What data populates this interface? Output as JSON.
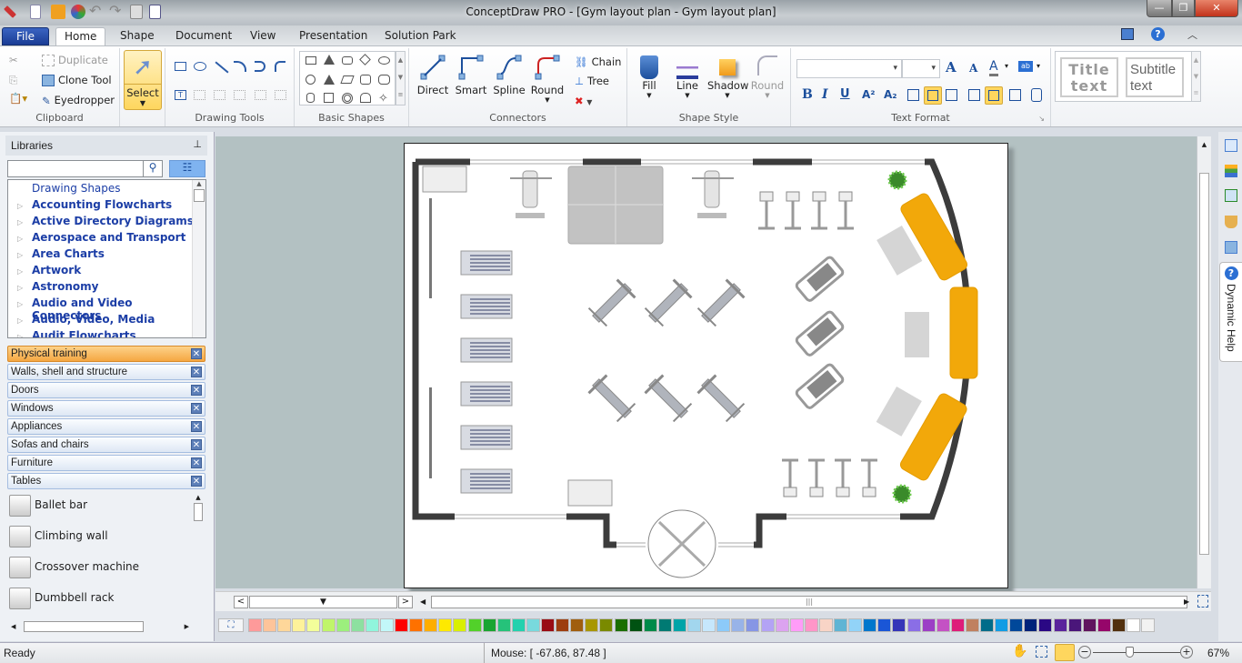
{
  "app": {
    "title": "ConceptDraw PRO - [Gym layout plan - Gym layout plan]"
  },
  "quick_access": [
    "pen-icon",
    "new-document-icon",
    "open-icon",
    "colors-icon",
    "undo-icon",
    "redo-icon",
    "save-icon",
    "print-preview-icon"
  ],
  "window_controls": {
    "minimize": "—",
    "restore": "❐",
    "close": "✕"
  },
  "tabs": [
    {
      "label": "File",
      "active": false
    },
    {
      "label": "Home",
      "active": true
    },
    {
      "label": "Shape",
      "active": false
    },
    {
      "label": "Document",
      "active": false
    },
    {
      "label": "View",
      "active": false
    },
    {
      "label": "Presentation",
      "active": false
    },
    {
      "label": "Solution Park",
      "active": false
    }
  ],
  "ribbon": {
    "clipboard": {
      "label": "Clipboard",
      "duplicate": "Duplicate",
      "clone_tool": "Clone Tool",
      "eyedropper": "Eyedropper"
    },
    "select": {
      "label": "Select"
    },
    "drawing_tools": {
      "label": "Drawing Tools"
    },
    "basic_shapes": {
      "label": "Basic Shapes"
    },
    "connectors": {
      "label": "Connectors",
      "direct": "Direct",
      "smart": "Smart",
      "spline": "Spline",
      "round": "Round",
      "chain": "Chain",
      "tree": "Tree"
    },
    "shape_style": {
      "label": "Shape Style",
      "fill": "Fill",
      "line": "Line",
      "shadow": "Shadow",
      "round": "Round"
    },
    "text_format": {
      "label": "Text Format",
      "font_value": "",
      "size_value": "",
      "bold": "B",
      "italic": "I",
      "underline": "U",
      "superscript": "A²",
      "subscript": "A₂"
    },
    "text_styles": {
      "title": "Title text",
      "subtitle": "Subtitle text"
    }
  },
  "libraries": {
    "title": "Libraries",
    "search_placeholder": "",
    "tree": [
      "Drawing Shapes",
      "Accounting Flowcharts",
      "Active Directory Diagrams",
      "Aerospace and Transport",
      "Area Charts",
      "Artwork",
      "Astronomy",
      "Audio and Video Connectors",
      "Audio, Video, Media",
      "Audit Flowcharts"
    ],
    "open_libraries": [
      {
        "label": "Physical training",
        "active": true
      },
      {
        "label": "Walls, shell and structure",
        "active": false
      },
      {
        "label": "Doors",
        "active": false
      },
      {
        "label": "Windows",
        "active": false
      },
      {
        "label": "Appliances",
        "active": false
      },
      {
        "label": "Sofas and chairs",
        "active": false
      },
      {
        "label": "Furniture",
        "active": false
      },
      {
        "label": "Tables",
        "active": false
      }
    ],
    "shapes": [
      "Ballet bar",
      "Climbing wall",
      "Crossover machine",
      "Dumbbell rack"
    ]
  },
  "right_sidebar": {
    "icons": [
      "pages-icon",
      "layers-icon",
      "lock-icon",
      "format-painter-icon",
      "page-size-icon"
    ],
    "dynamic_help": "Dynamic Help"
  },
  "palette": {
    "colors": [
      "#fe9a9a",
      "#fec49a",
      "#fed79a",
      "#fef29a",
      "#f3fe9a",
      "#c0f56a",
      "#9cef7d",
      "#8de0a0",
      "#90f5dc",
      "#c2f7f9",
      "#fe0000",
      "#fe7100",
      "#feae00",
      "#fee900",
      "#d9ef00",
      "#52d12a",
      "#1aa532",
      "#26c27a",
      "#24d1ae",
      "#78d9dd",
      "#990c14",
      "#9d3e10",
      "#a05e0e",
      "#a89700",
      "#7a8a00",
      "#1a6e00",
      "#005212",
      "#008a4a",
      "#007a73",
      "#00a4a8",
      "#a2d6ee",
      "#c6e7fc",
      "#8ccaf9",
      "#98b3e8",
      "#8696e5",
      "#b3a3f5",
      "#dca3f0",
      "#ff9cf8",
      "#ff96c8",
      "#f8d4c6",
      "#5fb4d4",
      "#92d3f8",
      "#0077cc",
      "#1a56d6",
      "#3535b8",
      "#8a6ee6",
      "#9c3ec6",
      "#c452c4",
      "#de1c7a",
      "#c08060",
      "#006c8a",
      "#119ce4",
      "#00489a",
      "#00237a",
      "#2a0884",
      "#5a249c",
      "#4a167a",
      "#60145e",
      "#96066a",
      "#52300e",
      "#ffffff",
      "#f2f2f2"
    ]
  },
  "status": {
    "ready": "Ready",
    "mouse": "Mouse: [ -67.86, 87.48 ]",
    "zoom": "67%",
    "zoom_fraction": 0.42
  },
  "canvas": {
    "document": "Gym layout plan"
  }
}
